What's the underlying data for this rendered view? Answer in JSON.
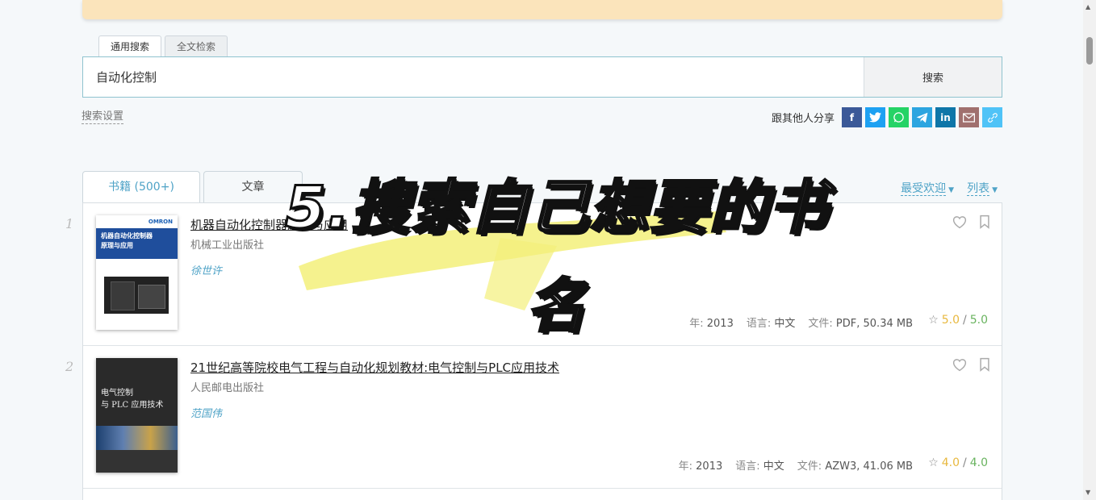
{
  "search": {
    "tabs": [
      "通用搜索",
      "全文检索"
    ],
    "query": "自动化控制",
    "button_label": "搜索",
    "settings_label": "搜索设置"
  },
  "share": {
    "label": "跟其他人分享",
    "buttons": [
      {
        "name": "facebook",
        "color": "#3b5998",
        "glyph": "f"
      },
      {
        "name": "twitter",
        "color": "#1da1f2",
        "glyph": "t"
      },
      {
        "name": "whatsapp",
        "color": "#25d366",
        "glyph": "w"
      },
      {
        "name": "telegram",
        "color": "#2ca5e0",
        "glyph": "➤"
      },
      {
        "name": "linkedin",
        "color": "#0e76a8",
        "glyph": "in"
      },
      {
        "name": "email",
        "color": "#a0706e",
        "glyph": "✉"
      },
      {
        "name": "link",
        "color": "#4fc3f7",
        "glyph": "🔗"
      }
    ]
  },
  "results": {
    "tabs": [
      {
        "label": "书籍 (500+)"
      },
      {
        "label": "文章"
      }
    ],
    "sort_label": "最受欢迎",
    "view_label": "列表",
    "items": [
      {
        "index": "1",
        "title": "机器自动化控制器原理与应用",
        "publisher": "机械工业出版社",
        "author": "徐世许",
        "year_label": "年:",
        "year": "2013",
        "lang_label": "语言:",
        "lang": "中文",
        "file_label": "文件:",
        "file": "PDF, 50.34 MB",
        "rating_a": "5.0",
        "rating_b": "5.0",
        "cover_text": "机器自动化控制器\n原理与应用",
        "cover_brand": "OMRON"
      },
      {
        "index": "2",
        "title": "21世纪高等院校电气工程与自动化规划教材:电气控制与PLC应用技术",
        "publisher": "人民邮电出版社",
        "author": "范国伟",
        "year_label": "年:",
        "year": "2013",
        "lang_label": "语言:",
        "lang": "中文",
        "file_label": "文件:",
        "file": "AZW3, 41.06 MB",
        "rating_a": "4.0",
        "rating_b": "4.0",
        "cover_text": "电气控制\n与 PLC 应用技术"
      }
    ]
  },
  "overlay": {
    "line1": "5.搜索自己想要的书",
    "line2": "名",
    "highlight_color": "#f3f07a"
  }
}
